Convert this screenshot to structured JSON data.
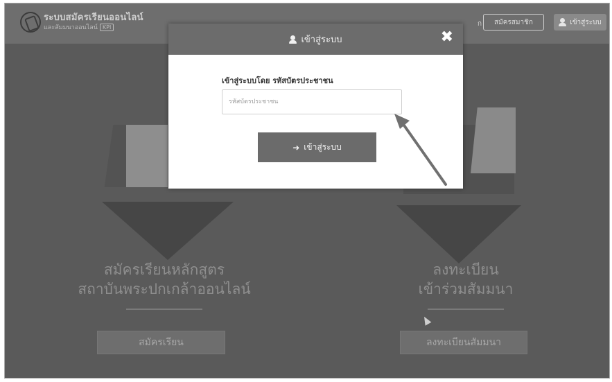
{
  "header": {
    "site_title": "ระบบสมัครเรียนออนไลน์",
    "site_subtitle": "และสัมมนาออนไลน์",
    "site_subtitle_badge": "KPI",
    "partial_link": "ก",
    "register_button": "สมัครสมาชิก",
    "login_button": "เข้าสู่ระบบ"
  },
  "modal": {
    "title": "เข้าสู่ระบบ",
    "close_symbol": "✖",
    "field_label": "เข้าสู่ระบบโดย รหัสบัตรประชาชน",
    "id_placeholder": "รหัสบัตรประชาชน",
    "id_value": "",
    "submit_icon": "➜",
    "submit_label": "เข้าสู่ระบบ"
  },
  "hero": {
    "left_line1": "สมัครเรียนหลักสูตร",
    "left_line2": "สถาบันพระปกเกล้าออนไลน์",
    "left_button": "สมัครเรียน",
    "right_line1": "ลงทะเบียน",
    "right_line2": "เข้าร่วมสัมมนา",
    "right_button": "ลงทะเบียนสัมมนา"
  },
  "colors": {
    "overlay_bg": "#5a5a5a",
    "modal_header": "#6c6c6c",
    "annotation_arrow": "#707070"
  }
}
